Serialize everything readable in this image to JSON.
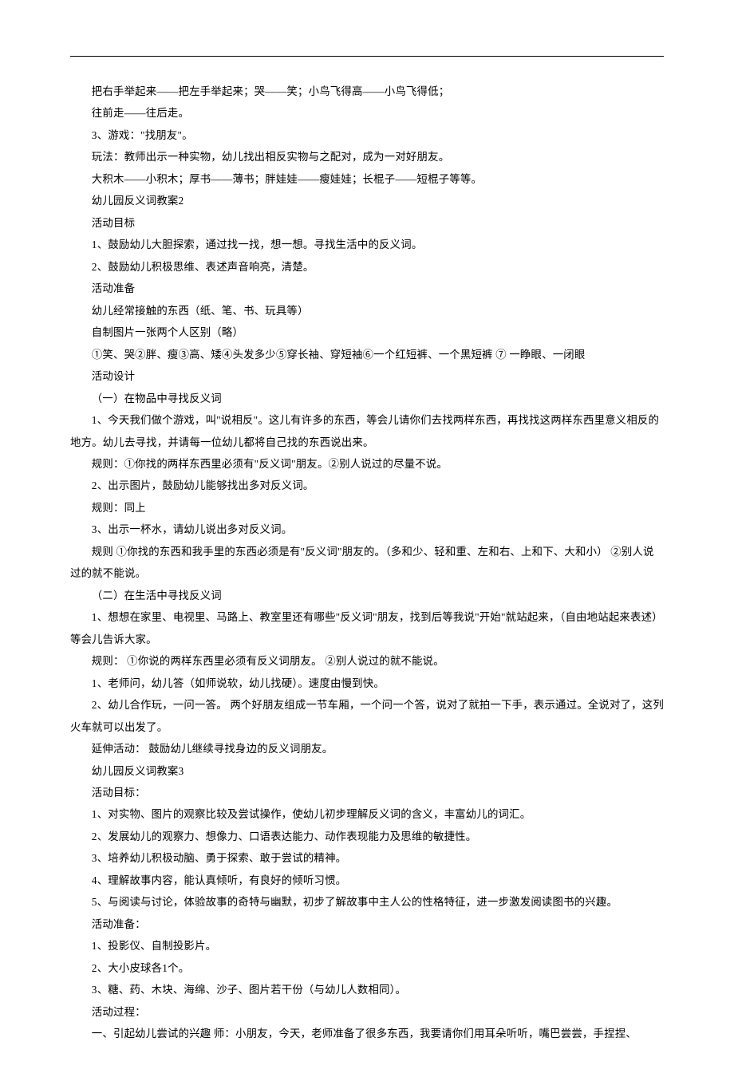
{
  "lines": [
    "把右手举起来——把左手举起来；哭——笑；小鸟飞得高——小鸟飞得低；",
    "往前走——往后走。",
    "3、游戏：\"找朋友\"。",
    "玩法：教师出示一种实物，幼儿找出相反实物与之配对，成为一对好朋友。",
    "大积木——小积木；厚书——薄书；胖娃娃——瘦娃娃；长棍子——短棍子等等。",
    "幼儿园反义词教案2",
    "活动目标",
    "1、鼓励幼儿大胆探索，通过找一找，想一想。寻找生活中的反义词。",
    "2、鼓励幼儿积极思维、表述声音响亮，清楚。",
    "活动准备",
    "幼儿经常接触的东西（纸、笔、书、玩具等）",
    "自制图片一张两个人区别（略）",
    "①笑、哭②胖、瘦③高、矮④头发多少⑤穿长袖、穿短袖⑥一个红短裤、一个黑短裤 ⑦ 一睁眼、一闭眼",
    "活动设计",
    "（一）在物品中寻找反义词",
    "1、今天我们做个游戏，叫\"说相反\"。这儿有许多的东西，等会儿请你们去找两样东西，再找找这两样东西里意义相反的地方。幼儿去寻找，并请每一位幼儿都将自己找的东西说出来。",
    "规则：①你找的两样东西里必须有\"反义词\"朋友。②别人说过的尽量不说。",
    "2、出示图片，鼓励幼儿能够找出多对反义词。",
    "规则：同上",
    "3、出示一杯水，请幼儿说出多对反义词。",
    "规则 ①你找的东西和我手里的东西必须是有\"反义词\"朋友的。（多和少、轻和重、左和右、上和下、大和小） ②别人说过的就不能说。",
    "（二）在生活中寻找反义词",
    "1、想想在家里、电视里、马路上、教室里还有哪些\"反义词\"朋友，找到后等我说\"开始\"就站起来，（自由地站起来表述）等会儿告诉大家。",
    "规则： ①你说的两样东西里必须有反义词朋友。 ②别人说过的就不能说。",
    "1、老师问，幼儿答（如师说软，幼儿找硬）。速度由慢到快。",
    "2、幼儿合作玩，一问一答。 两个好朋友组成一节车厢，一个问一个答，说对了就拍一下手，表示通过。全说对了，这列火车就可以出发了。",
    "延伸活动： 鼓励幼儿继续寻找身边的反义词朋友。",
    "幼儿园反义词教案3",
    "活动目标：",
    "1、对实物、图片的观察比较及尝试操作，使幼儿初步理解反义词的含义，丰富幼儿的词汇。",
    "2、发展幼儿的观察力、想像力、口语表达能力、动作表现能力及思维的敏捷性。",
    "3、培养幼儿积极动脑、勇于探索、敢于尝试的精神。",
    "4、理解故事内容，能认真倾听，有良好的倾听习惯。",
    "5、与阅读与讨论，体验故事的奇特与幽默，初步了解故事中主人公的性格特征，进一步激发阅读图书的兴趣。",
    "活动准备：",
    "1、投影仪、自制投影片。",
    "2、大小皮球各1个。",
    "3、糖、药、木块、海绵、沙子、图片若干份（与幼儿人数相同）。",
    "活动过程：",
    "一、引起幼儿尝试的兴趣 师：小朋友，今天，老师准备了很多东西，我要请你们用耳朵听听，嘴巴尝尝，手捏捏、"
  ]
}
